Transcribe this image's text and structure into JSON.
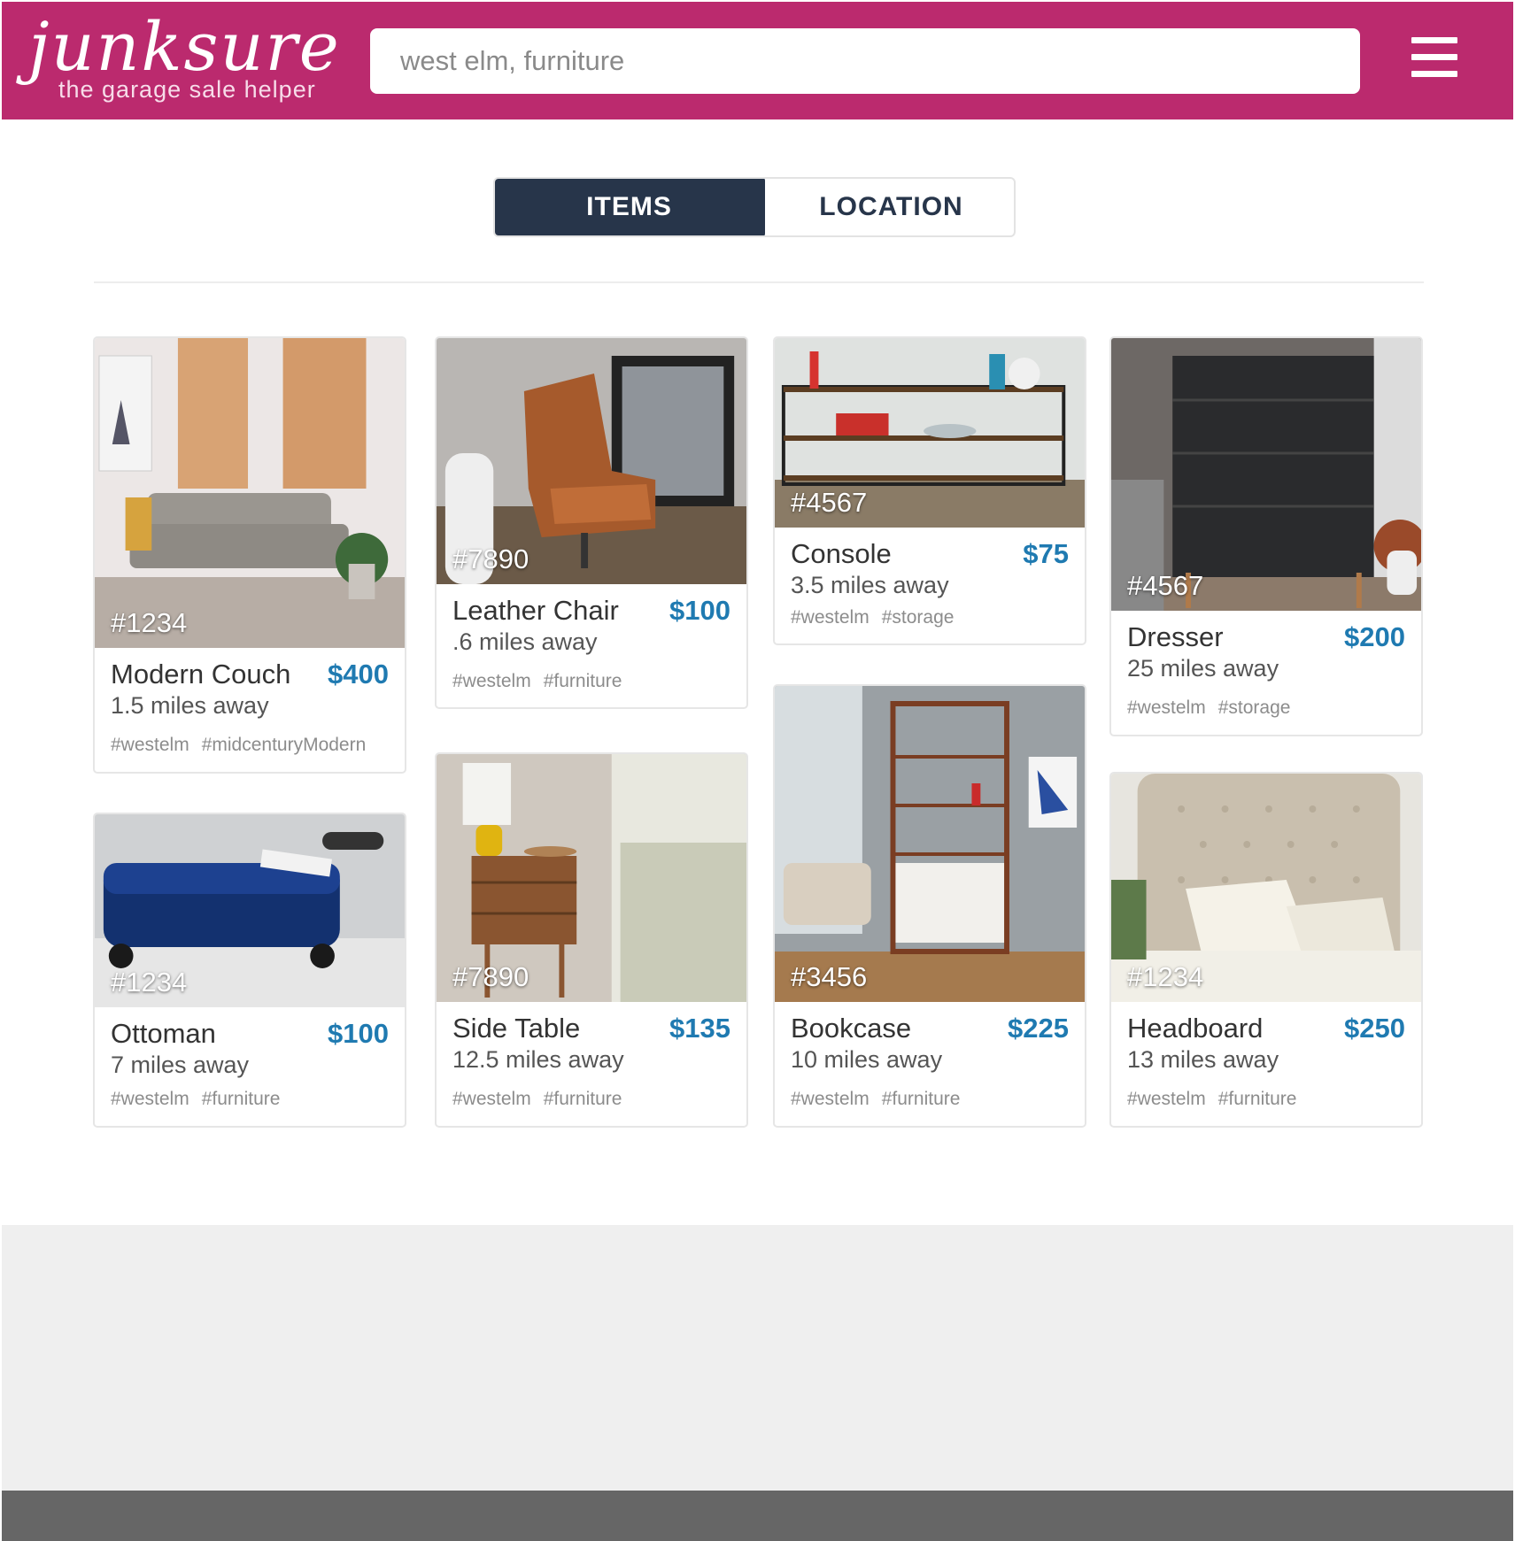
{
  "header": {
    "logo_word": "junksure",
    "logo_tagline": "the garage sale helper",
    "search_placeholder": "west elm, furniture",
    "menu_icon": "hamburger-icon",
    "background": "#bb2a6e"
  },
  "tabs": [
    {
      "label": "ITEMS",
      "active": true
    },
    {
      "label": "LOCATION",
      "active": false
    }
  ],
  "colors": {
    "accent_price": "#1f7ab1",
    "tab_active": "#27354a"
  },
  "items": [
    {
      "id": "#1234",
      "name": "Modern Couch",
      "price": "$400",
      "distance": "1.5 miles away",
      "tags": [
        "#westelm",
        "#midcenturyModern"
      ]
    },
    {
      "id": "#7890",
      "name": "Leather Chair",
      "price": "$100",
      "distance": ".6 miles away",
      "tags": [
        "#westelm",
        "#furniture"
      ]
    },
    {
      "id": "#4567",
      "name": "Console",
      "price": "$75",
      "distance": "3.5 miles away",
      "tags": [
        "#westelm",
        "#storage"
      ]
    },
    {
      "id": "#4567",
      "name": "Dresser",
      "price": "$200",
      "distance": "25 miles away",
      "tags": [
        "#westelm",
        "#storage"
      ]
    },
    {
      "id": "#1234",
      "name": "Ottoman",
      "price": "$100",
      "distance": "7 miles away",
      "tags": [
        "#westelm",
        "#furniture"
      ]
    },
    {
      "id": "#7890",
      "name": "Side Table",
      "price": "$135",
      "distance": "12.5 miles away",
      "tags": [
        "#westelm",
        "#furniture"
      ]
    },
    {
      "id": "#3456",
      "name": "Bookcase",
      "price": "$225",
      "distance": "10 miles away",
      "tags": [
        "#westelm",
        "#furniture"
      ]
    },
    {
      "id": "#1234",
      "name": "Headboard",
      "price": "$250",
      "distance": "13 miles away",
      "tags": [
        "#westelm",
        "#furniture"
      ]
    }
  ]
}
